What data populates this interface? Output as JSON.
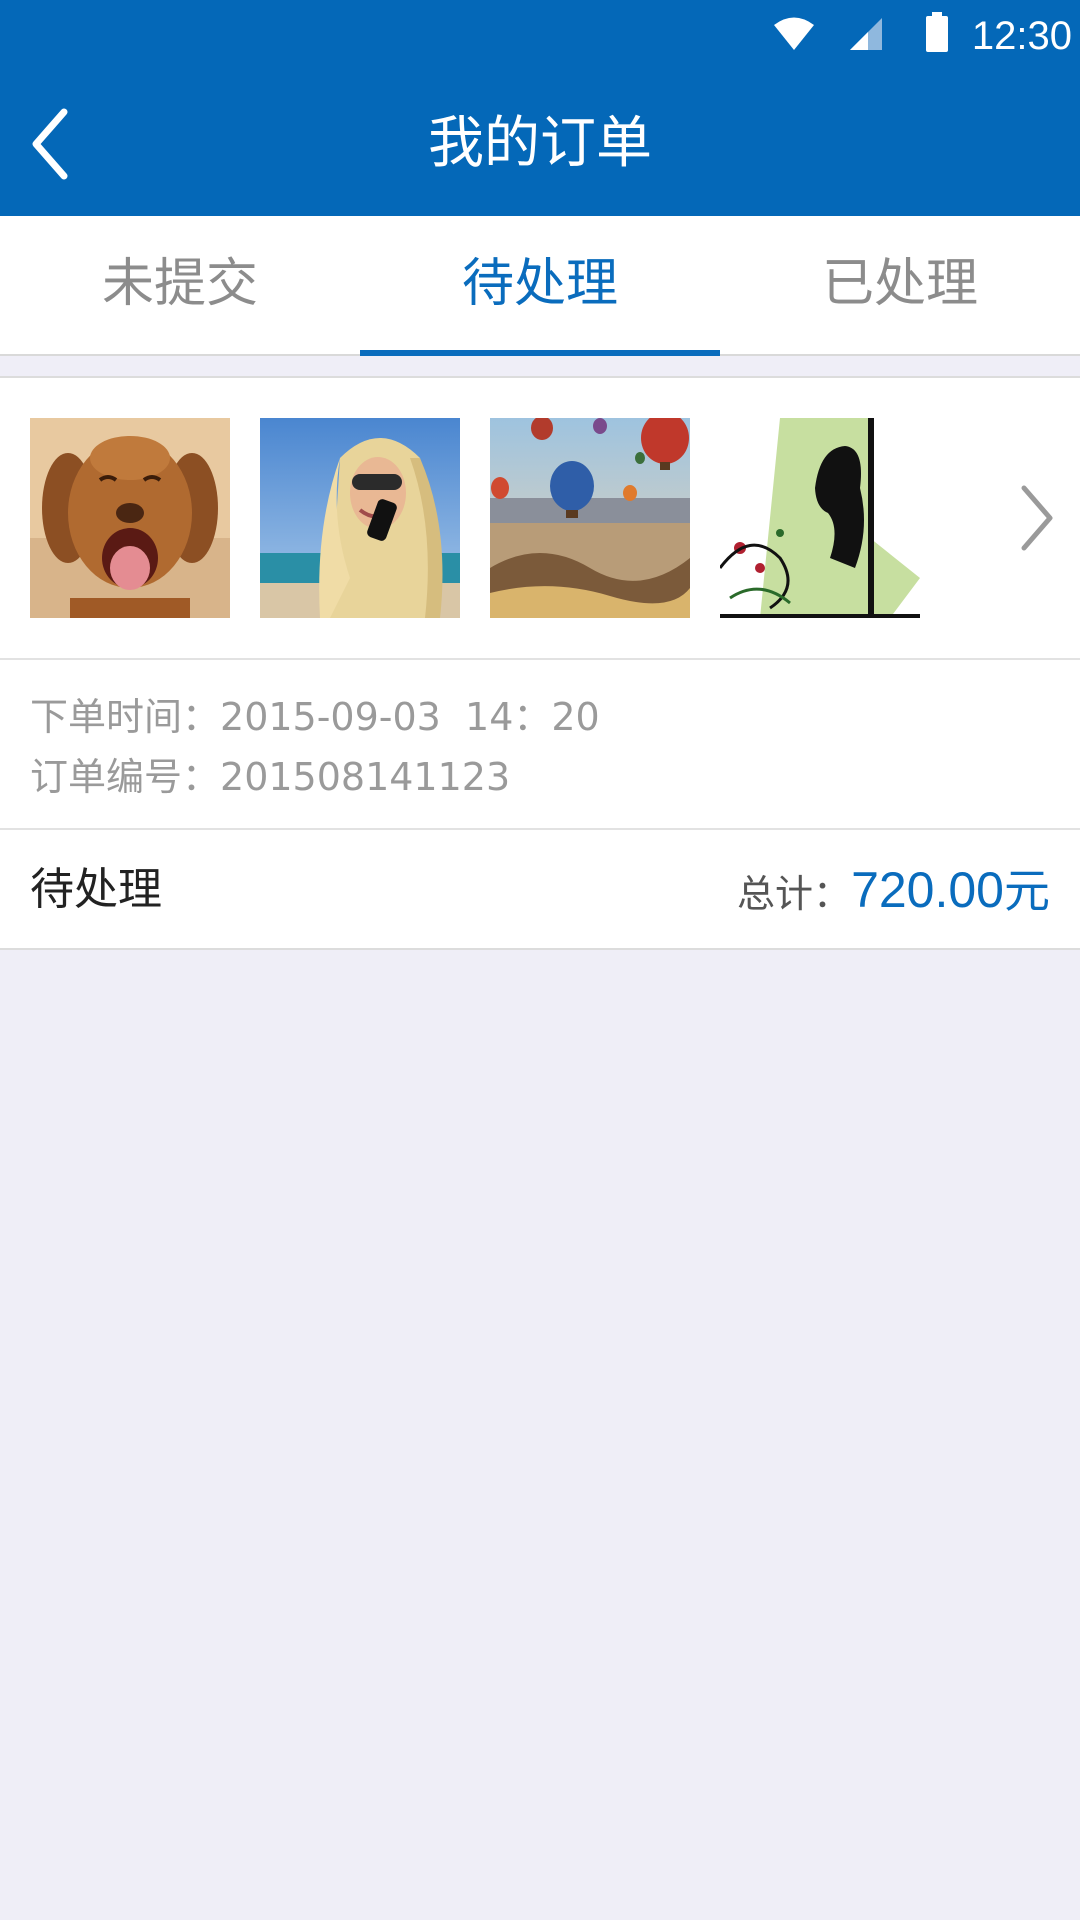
{
  "status_bar": {
    "time": "12:30",
    "icons": [
      "wifi-icon",
      "signal-icon",
      "battery-icon"
    ]
  },
  "app_bar": {
    "title": "我的订单",
    "back_icon": "chevron-left-icon"
  },
  "tabs": [
    {
      "label": "未提交",
      "active": false
    },
    {
      "label": "待处理",
      "active": true
    },
    {
      "label": "已处理",
      "active": false
    }
  ],
  "order": {
    "images": [
      "puppy-photo",
      "woman-on-phone-photo",
      "hot-air-balloons-photo",
      "silhouette-illustration"
    ],
    "time_label": "下单时间：",
    "time_value": "2015-09-03  14：20",
    "number_label": "订单编号：",
    "number_value": "201508141123",
    "status": "待处理",
    "total_label": "总计：",
    "total_amount": "720.00",
    "total_unit": "元"
  },
  "colors": {
    "primary": "#0468b8",
    "accent": "#0a6cbd",
    "background": "#efeef7"
  }
}
